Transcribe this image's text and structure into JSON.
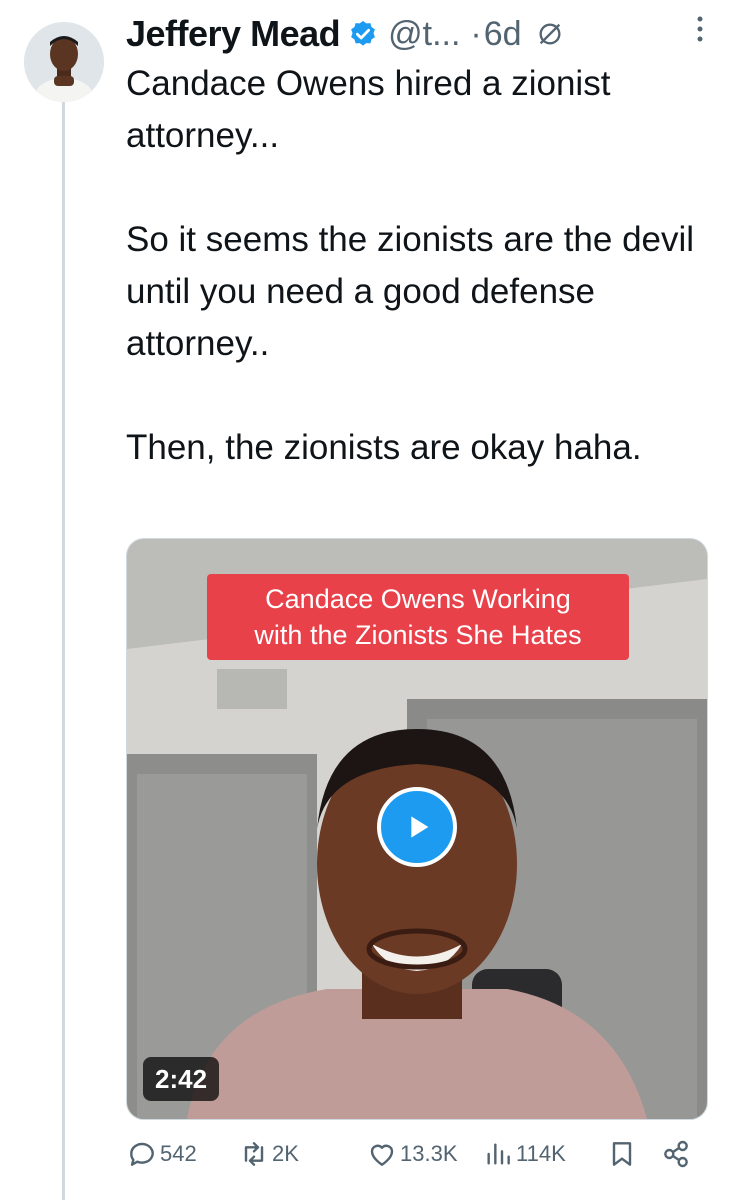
{
  "author": {
    "name": "Jeffery Mead",
    "handle": "@t...",
    "separator": "·",
    "age": "6d",
    "verified": true
  },
  "tweet": {
    "paragraphs": [
      "Candace Owens hired a zionist attorney...",
      "So it seems the zionists are the devil until you need a good defense attorney..",
      "Then, the zionists are okay haha."
    ]
  },
  "media": {
    "type": "video",
    "caption_line1": "Candace Owens Working",
    "caption_line2": "with the Zionists She Hates",
    "duration": "2:42"
  },
  "actions": {
    "replies": "542",
    "reposts": "2K",
    "likes": "13.3K",
    "views": "114K"
  },
  "icons": [
    "verified-badge-icon",
    "grok-icon",
    "more-icon",
    "play-icon",
    "reply-icon",
    "repost-icon",
    "like-icon",
    "views-icon",
    "bookmark-icon",
    "share-icon"
  ],
  "colors": {
    "accent": "#1d9bf0",
    "secondary_text": "#536471",
    "caption_bg": "#e8414a"
  }
}
